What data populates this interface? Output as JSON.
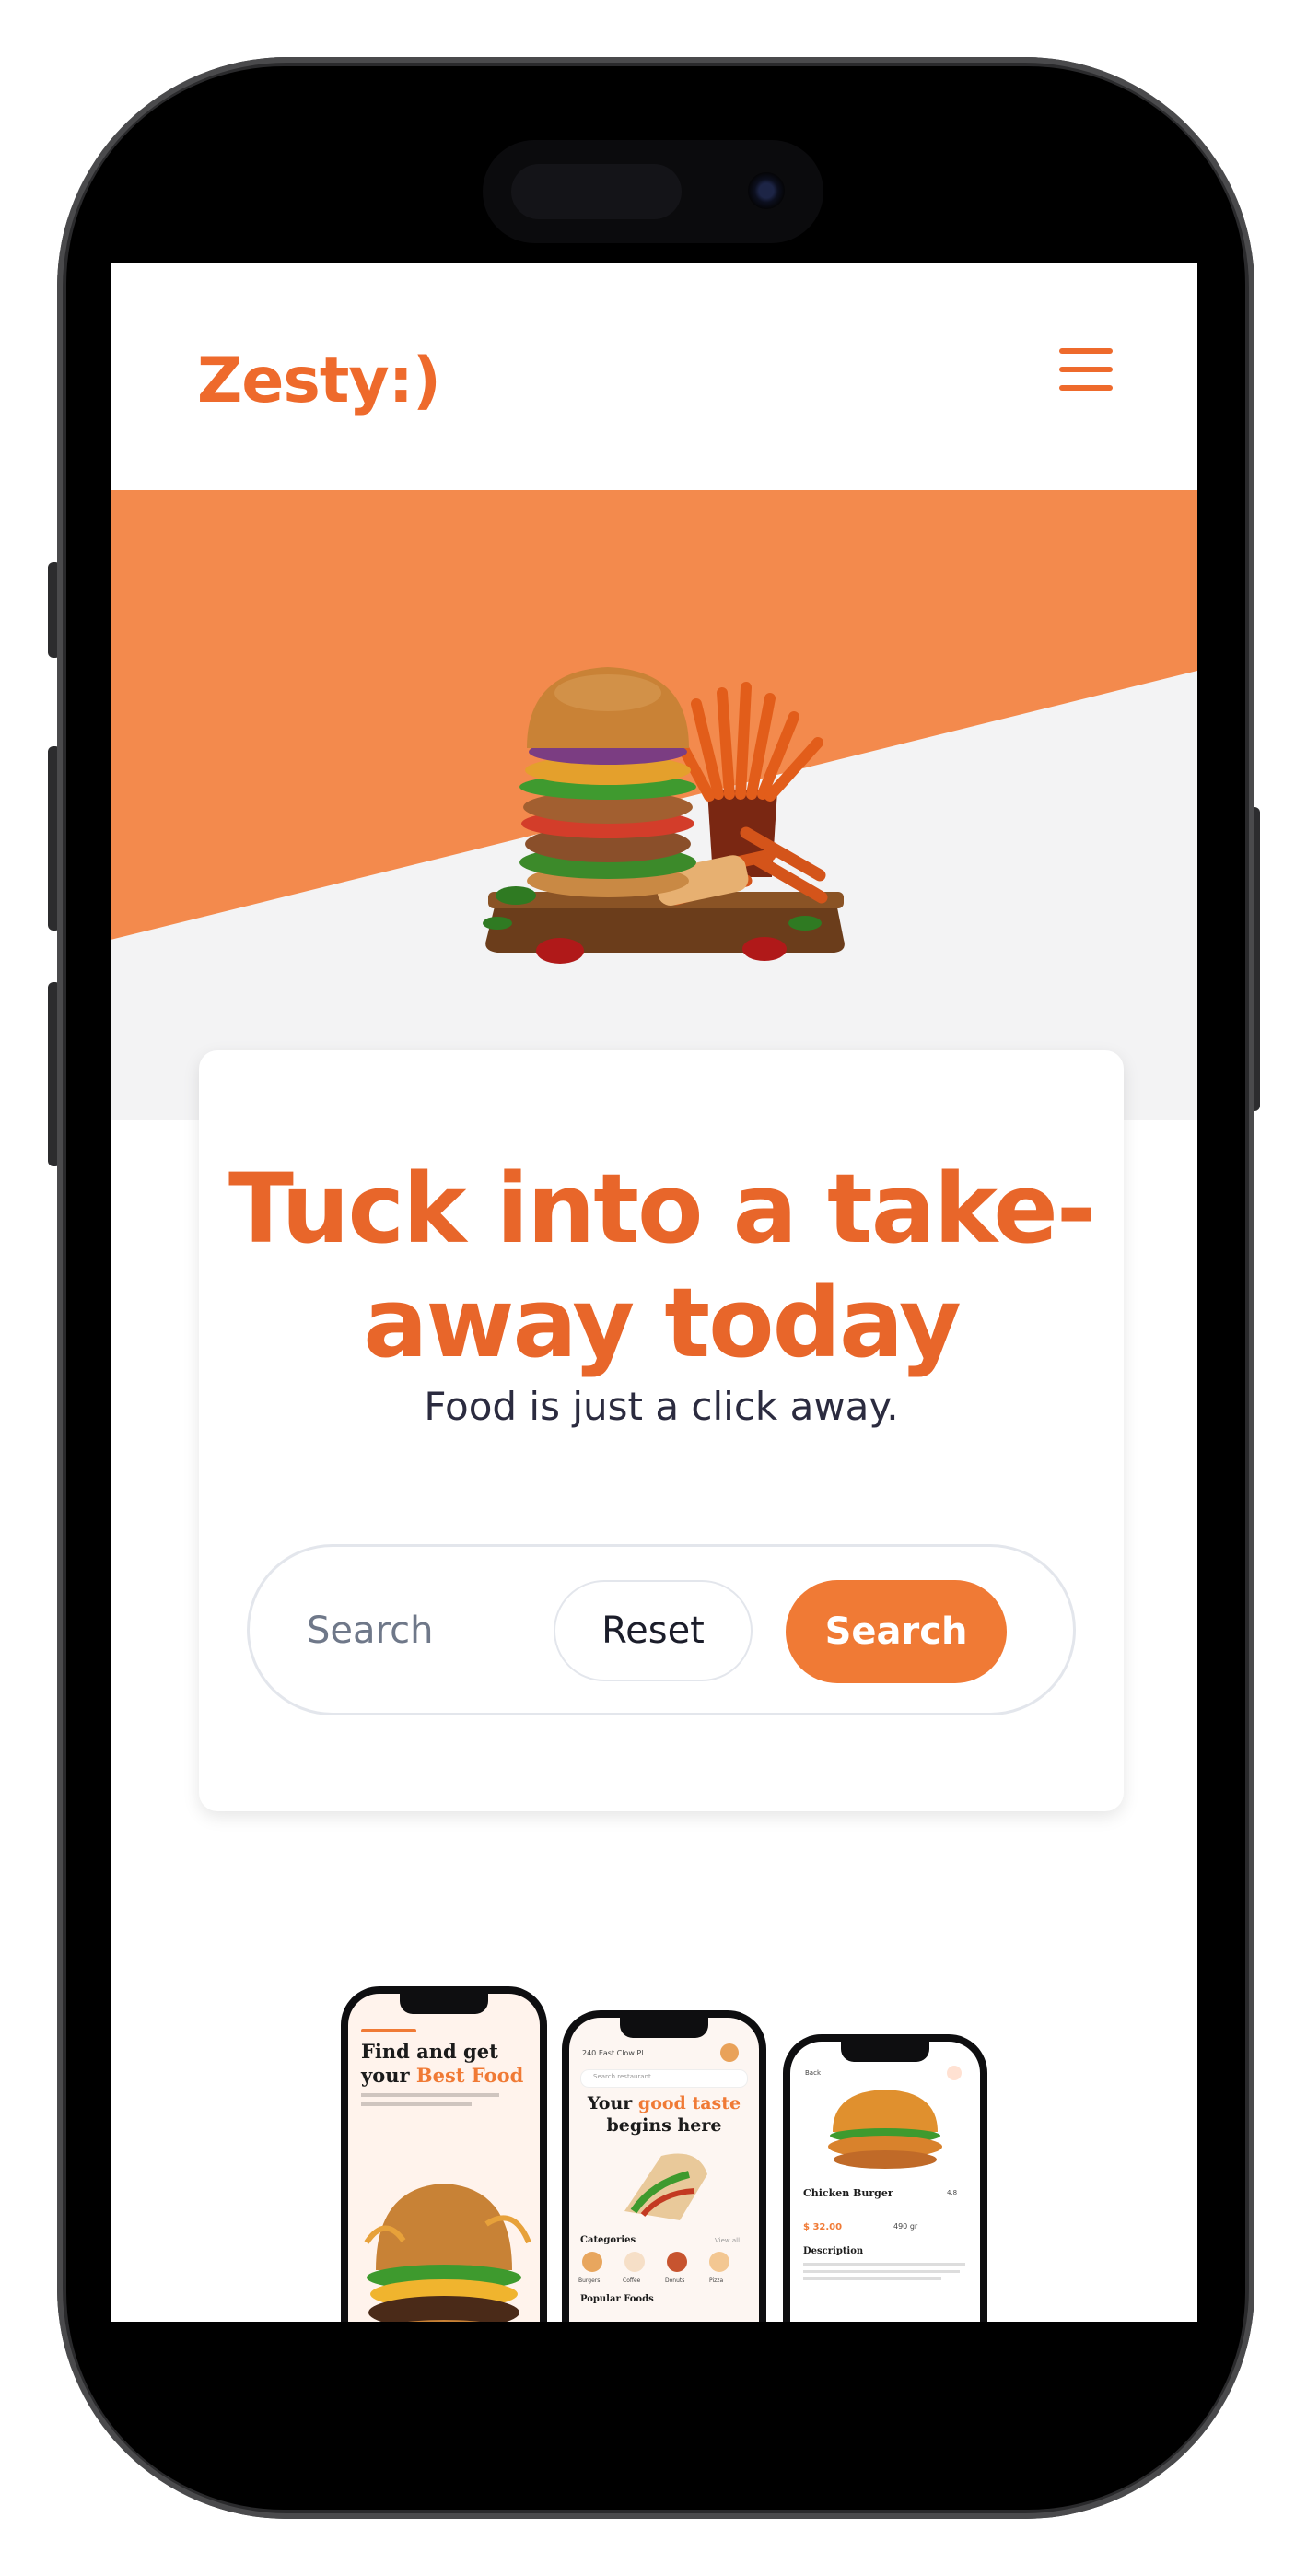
{
  "app": {
    "logo": "Zesty:)"
  },
  "header": {
    "menu_icon": "hamburger-menu-icon"
  },
  "hero": {
    "image": "burger-and-fries-board-image",
    "title": "Tuck into a take-away today",
    "subtitle": "Food is just a click away."
  },
  "search": {
    "placeholder": "Search",
    "value": "",
    "reset_label": "Reset",
    "submit_label": "Search"
  },
  "mockups": {
    "phone1": {
      "title_line1": "Find and get",
      "title_line2_prefix": "your ",
      "title_line2_accent": "Best Food"
    },
    "phone2": {
      "location": "240 East Clow Pl.",
      "search_placeholder": "Search restaurant",
      "headline_prefix": "Your ",
      "headline_accent": "good taste",
      "headline_line2": "begins here",
      "categories_label": "Categories",
      "view_all": "View all",
      "category_items": [
        "Burgers",
        "Coffee",
        "Donuts",
        "Pizza"
      ],
      "popular_label": "Popular Foods"
    },
    "phone3": {
      "back": "Back",
      "product_name": "Chicken Burger",
      "rating": "4.8",
      "price": "$ 32.00",
      "weight": "490 gr",
      "description_label": "Description"
    }
  },
  "colors": {
    "brand_orange": "#ee6a2c",
    "hero_band": "#f38a4d",
    "hero_bg": "#f3f3f4",
    "search_button": "#f07a35"
  }
}
